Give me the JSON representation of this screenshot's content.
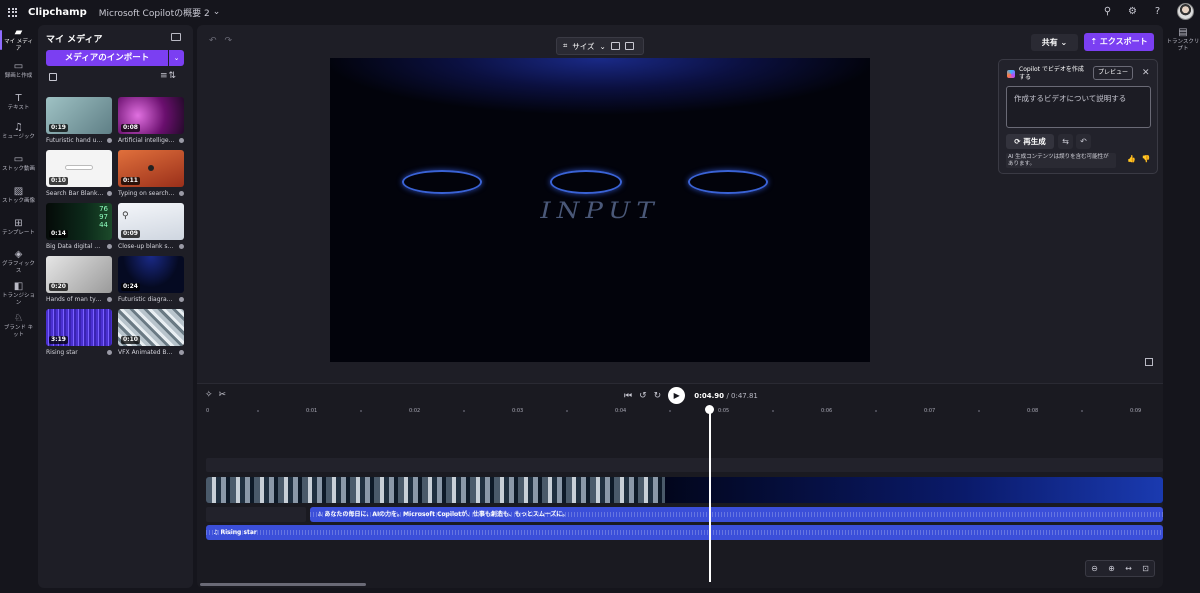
{
  "app": {
    "name": "Clipchamp",
    "project_title": "Microsoft Copilotの概要 2"
  },
  "topbar": {
    "icons": [
      "connect-icon",
      "settings-icon",
      "help-icon"
    ]
  },
  "rail": [
    {
      "label": "マイ メディア",
      "icon": "folder-icon",
      "active": true
    },
    {
      "label": "録画と作成",
      "icon": "camera-icon"
    },
    {
      "label": "テキスト",
      "icon": "text-icon"
    },
    {
      "label": "ミュージック",
      "icon": "music-icon"
    },
    {
      "label": "ストック動画",
      "icon": "video-icon"
    },
    {
      "label": "ストック画像",
      "icon": "image-icon"
    },
    {
      "label": "テンプレート",
      "icon": "template-icon"
    },
    {
      "label": "グラフィックス",
      "icon": "graphics-icon"
    },
    {
      "label": "トランジション",
      "icon": "transition-icon"
    },
    {
      "label": "ブランド キット",
      "icon": "brand-icon"
    }
  ],
  "media": {
    "title": "マイ メディア",
    "import_label": "メディアのインポート",
    "items": [
      {
        "duration": "0:19",
        "caption": "Futuristic hand usin...",
        "thumb": "#8fb0b3"
      },
      {
        "duration": "0:08",
        "caption": "Artificial intelligenc...",
        "thumb": "#8a1f8f"
      },
      {
        "duration": "0:10",
        "caption": "Search Bar Blank A...",
        "thumb": "#f2f2f2"
      },
      {
        "duration": "0:11",
        "caption": "Typing on search b...",
        "thumb": "#c4502a"
      },
      {
        "duration": "0:14",
        "caption": "Big Data digital dis...",
        "thumb": "#0c2a1a"
      },
      {
        "duration": "0:09",
        "caption": "Close-up blank sear...",
        "thumb": "#e6eaf0"
      },
      {
        "duration": "0:20",
        "caption": "Hands of man typin...",
        "thumb": "#c9c9c9"
      },
      {
        "duration": "0:24",
        "caption": "Futuristic diagram s...",
        "thumb": "#050a22"
      },
      {
        "duration": "3:19",
        "caption": "Rising star",
        "thumb": "#5a3fe0"
      },
      {
        "duration": "0:10",
        "caption": "VFX Animated Back...",
        "thumb": "#a0b0b8"
      }
    ]
  },
  "editor": {
    "size_label": "サイズ",
    "share_label": "共有",
    "export_label": "エクスポート",
    "canvas_text": "INPUT"
  },
  "copilot": {
    "title": "Copilot でビデオを作成する",
    "badge": "プレビュー",
    "placeholder": "作成するビデオについて説明する",
    "regenerate_label": "再生成",
    "note": "AI 生成コンテンツは誤りを含む可能性があります。"
  },
  "right_rail": {
    "label": "トランスクリプト"
  },
  "timeline": {
    "current_time": "0:04.90",
    "total_time": "/ 0:47.81",
    "ruler": [
      "0",
      "0:01",
      "0:02",
      "0:03",
      "0:04",
      "0:05",
      "0:06",
      "0:07",
      "0:08",
      "0:09"
    ],
    "voice_label": "あなたの毎日に、AIの力を。Microsoft Copilotが、仕事も創造も、もっとスムーズに。",
    "music_label": "Rising star",
    "playhead_seconds": 4.9
  }
}
